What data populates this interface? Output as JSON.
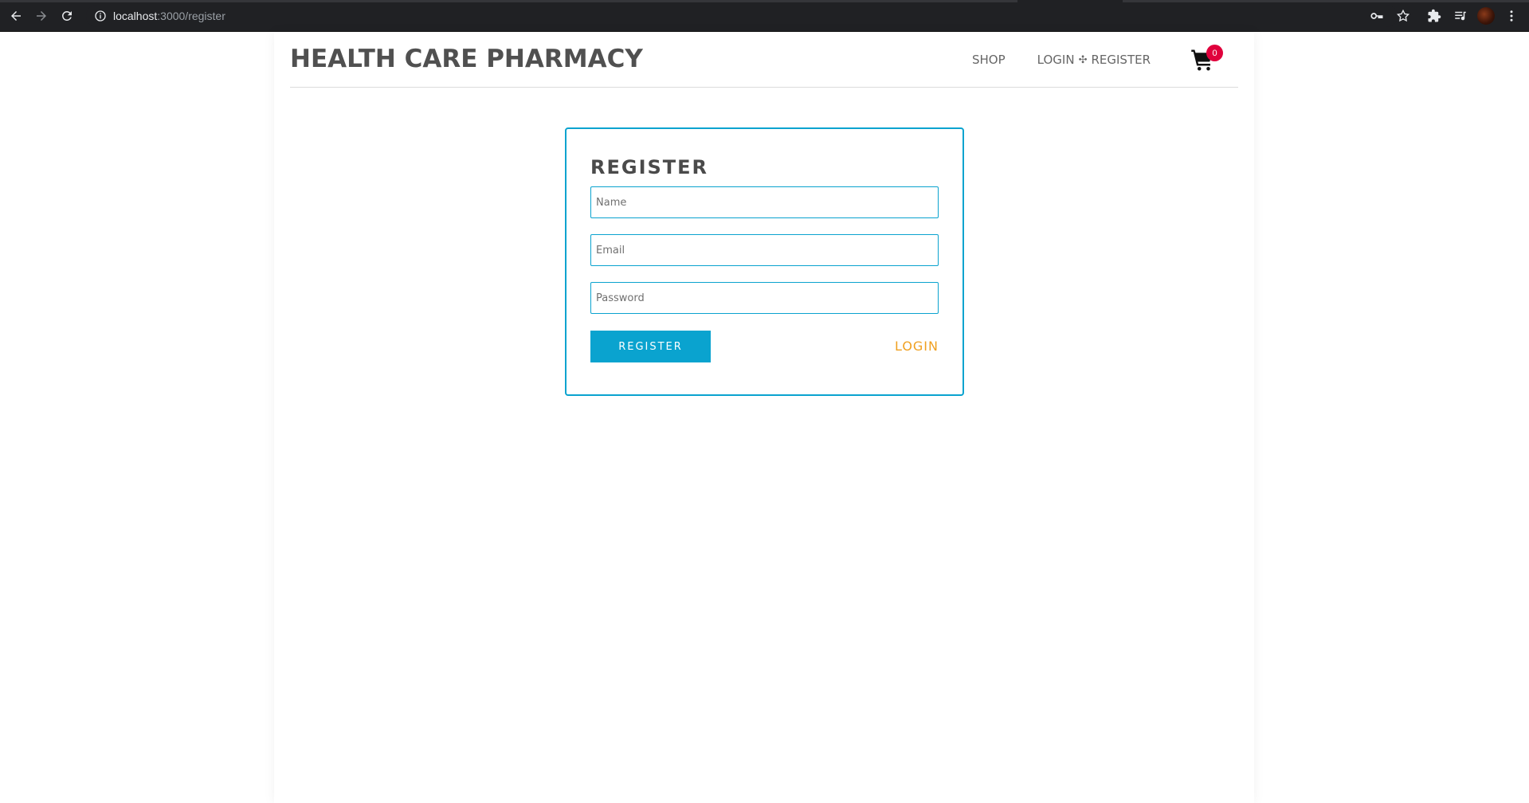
{
  "browser": {
    "url_host": "localhost",
    "url_path": ":3000/register",
    "icons": {
      "back": "arrow-left-icon",
      "forward": "arrow-right-icon",
      "reload": "reload-icon",
      "site_info": "info-icon",
      "password": "key-icon",
      "bookmark": "star-icon",
      "extensions": "puzzle-icon",
      "media": "playlist-icon",
      "profile": "avatar",
      "menu": "kebab-menu-icon"
    }
  },
  "header": {
    "brand": "HEALTH CARE PHARMACY",
    "nav": {
      "shop": "SHOP",
      "login": "LOGIN",
      "separator": "✣",
      "register": "REGISTER"
    },
    "cart": {
      "icon": "cart-icon",
      "count": "0",
      "badge_color": "#e0003c"
    }
  },
  "register_form": {
    "title": "REGISTER",
    "name_placeholder": "Name",
    "email_placeholder": "Email",
    "password_placeholder": "Password",
    "submit_label": "REGISTER",
    "login_link": "LOGIN"
  },
  "colors": {
    "accent": "#0aa3cf",
    "link": "#f0a020",
    "brand_text": "#505050"
  }
}
